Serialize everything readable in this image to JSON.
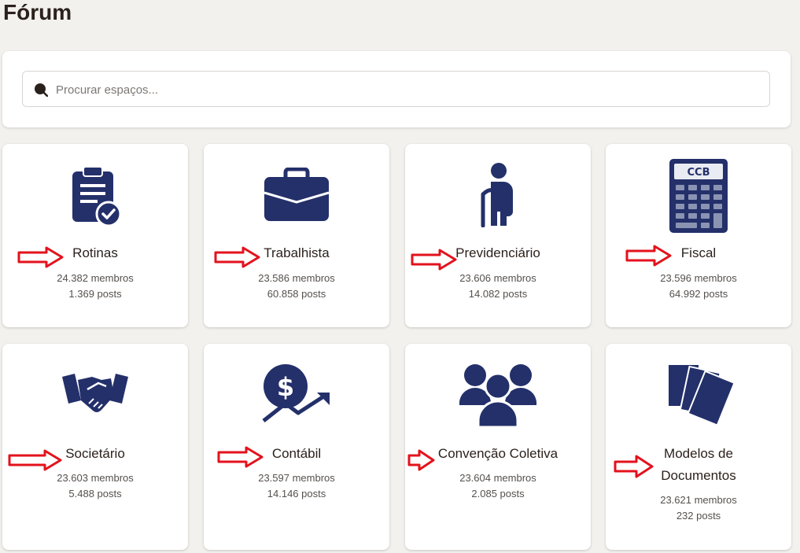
{
  "page": {
    "title": "Fórum"
  },
  "search": {
    "placeholder": "Procurar espaços..."
  },
  "colors": {
    "icon": "#24306a",
    "arrow": "#e3121c",
    "background": "#f3f1ed"
  },
  "spaces": [
    {
      "icon": "clipboard-check-icon",
      "name": "Rotinas",
      "members": "24.382 membros",
      "posts": "1.369 posts"
    },
    {
      "icon": "briefcase-icon",
      "name": "Trabalhista",
      "members": "23.586 membros",
      "posts": "60.858 posts"
    },
    {
      "icon": "elderly-person-icon",
      "name": "Previdenciário",
      "members": "23.606 membros",
      "posts": "14.082 posts"
    },
    {
      "icon": "calculator-icon",
      "name": "Fiscal",
      "members": "23.596 membros",
      "posts": "64.992 posts",
      "icon_text": "CCB"
    },
    {
      "icon": "handshake-icon",
      "name": "Societário",
      "members": "23.603 membros",
      "posts": "5.488 posts"
    },
    {
      "icon": "dollar-growth-icon",
      "name": "Contábil",
      "members": "23.597 membros",
      "posts": "14.146 posts"
    },
    {
      "icon": "users-group-icon",
      "name": "Convenção Coletiva",
      "members": "23.604 membros",
      "posts": "2.085 posts"
    },
    {
      "icon": "documents-stack-icon",
      "name_line1": "Modelos de",
      "name_line2": "Documentos",
      "members": "23.621 membros",
      "posts": "232 posts"
    }
  ]
}
